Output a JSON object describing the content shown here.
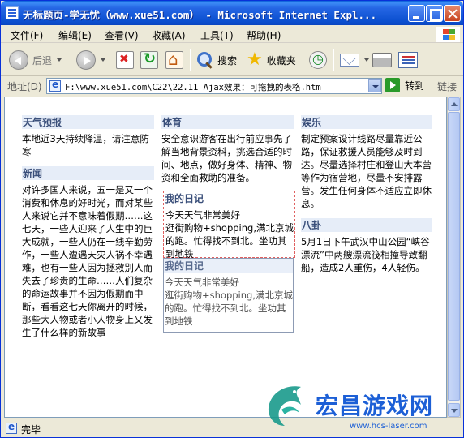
{
  "window": {
    "title": "无标题页-学无忧（www.xue51.com） - Microsoft Internet Expl..."
  },
  "menu": [
    "文件(F)",
    "编辑(E)",
    "查看(V)",
    "收藏(A)",
    "工具(T)",
    "帮助(H)"
  ],
  "toolbar": {
    "back_label": "后退",
    "search_label": "搜索",
    "favorites_label": "收藏夹"
  },
  "address": {
    "label": "地址(D)",
    "url": "F:\\www.xue51.com\\C22\\22.11  Ajax效果：可拖拽的表格.htm",
    "go_label": "转到",
    "links_label": "链接"
  },
  "columns": {
    "left": [
      {
        "title": "天气预报",
        "body": "本地近3天持续降温，请注意防寒"
      },
      {
        "title": "新闻",
        "body": "对许多国人来说，五一是又一个消费和休息的好时光，而对某些人来说它并不意味着假期……这七天，一些人迎来了人生中的巨大成就，一些人仍在一线辛勤劳作，一些人遭遇天灾人祸不幸遇难，也有一些人因为拯救别人而失去了珍贵的生命……人们复杂的命运故事并不因为假期而中断，看看这七天你离开的时候，那些大人物或者小人物身上又发生了什么样的新故事"
      }
    ],
    "middle": [
      {
        "title": "体育",
        "body": "安全意识游客在出行前应事先了解当地背景资料，挑选合适的时间、地点，做好身体、精神、物资和全面救助的准备。"
      }
    ],
    "right": [
      {
        "title": "娱乐",
        "body": "制定预案设计线路尽量靠近公路，保证救援人员能够及时到达。尽量选择村庄和登山大本营等作为宿营地，尽量不安排露营。发生任何身体不适应立即休息。"
      },
      {
        "title": "八卦",
        "body": "5月1日下午武汉中山公园“峡谷漂流”中两艘漂流筏相撞导致翻船，造成2人重伤，4人轻伤。"
      }
    ]
  },
  "dragged": {
    "title": "我的日记",
    "body": "今天天气非常美好\n逛街购物+shopping,满北京城的跑。忙得找不到北。坐功其到地铁"
  },
  "status": {
    "text": "完毕"
  },
  "watermark": {
    "title": "宏昌游戏网",
    "url": "www.hcs-laser.com"
  }
}
